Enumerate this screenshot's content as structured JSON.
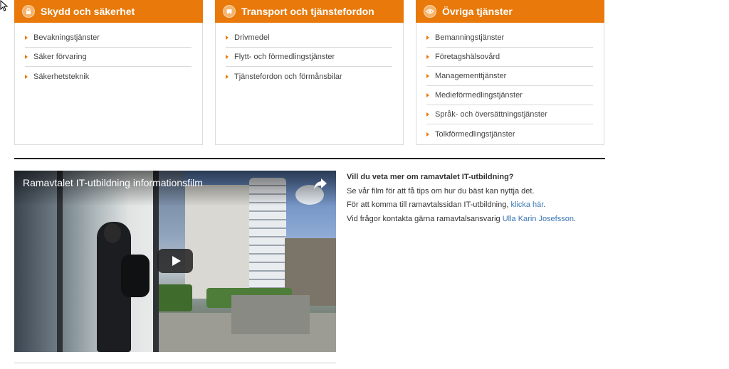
{
  "cards": [
    {
      "title": "Skydd och säkerhet",
      "icon": "lock-icon",
      "items": [
        "Bevakningstjänster",
        "Säker förvaring",
        "Säkerhetsteknik"
      ]
    },
    {
      "title": "Transport och tjänstefordon",
      "icon": "bus-icon",
      "items": [
        "Drivmedel",
        "Flytt- och förmedlingstjänster",
        "Tjänstefordon och förmånsbilar"
      ]
    },
    {
      "title": "Övriga tjänster",
      "icon": "eye-icon",
      "items": [
        "Bemanningstjänster",
        "Företagshälsovård",
        "Managementtjänster",
        "Medieförmedlingstjänster",
        "Språk- och översättningstjänster",
        "Tolkförmedlingstjänster"
      ]
    }
  ],
  "colors": {
    "accent": "#e8790a",
    "link": "#3a78b5"
  },
  "video": {
    "title": "Ramavtalet IT-utbildning informationsfilm"
  },
  "info": {
    "question": "Vill du veta mer om ramavtalet IT-utbildning?",
    "line1": "Se vår film för att få tips om hur du bäst kan nyttja det.",
    "line2_prefix": "För att komma till ramavtalssidan IT-utbildning, ",
    "line2_link": "klicka här",
    "line2_suffix": ".",
    "line3_prefix": "Vid frågor kontakta gärna ramavtalsansvarig ",
    "line3_link": "Ulla Karin Josefsson",
    "line3_suffix": "."
  }
}
